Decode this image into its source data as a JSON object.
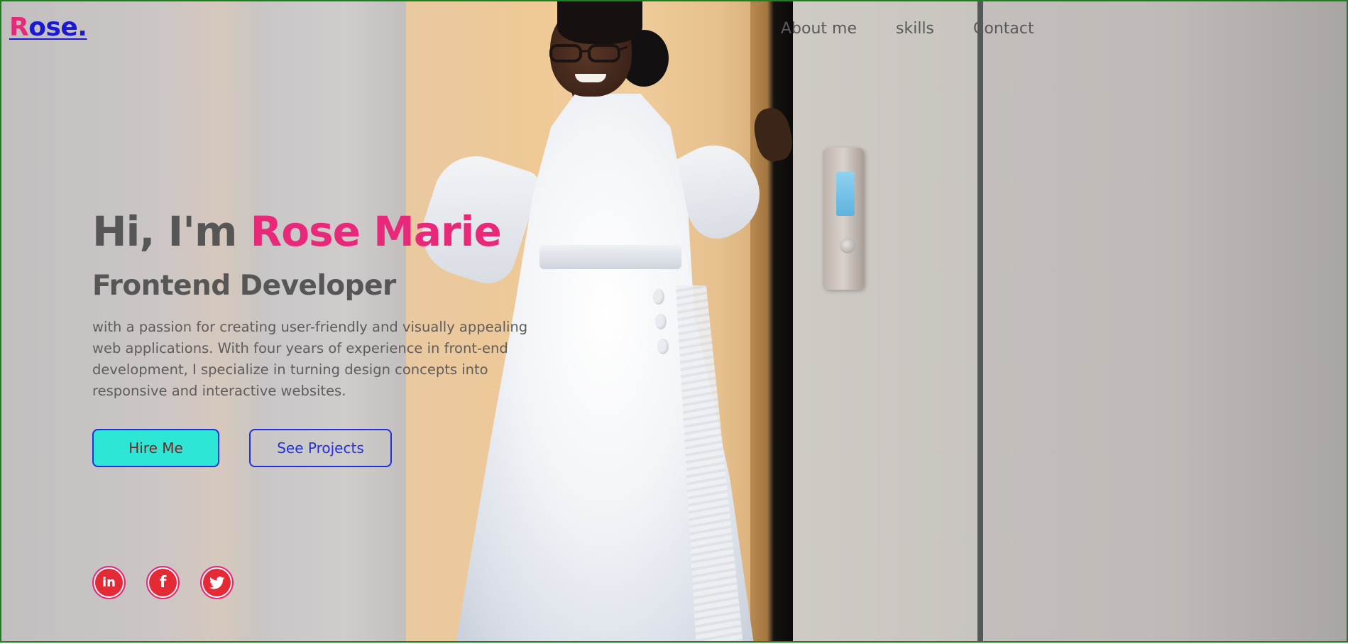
{
  "logo": {
    "initial": "R",
    "rest": "ose."
  },
  "nav": {
    "items": [
      {
        "label": "About me"
      },
      {
        "label": "skills"
      },
      {
        "label": "Contact"
      }
    ]
  },
  "hero": {
    "greeting": "Hi, I'm ",
    "name": "Rose Marie",
    "role": "Frontend Developer",
    "bio": "with a passion for creating user-friendly and visually appealing web applications. With four years of experience in front-end development, I specialize in turning design concepts into responsive and interactive websites.",
    "buttons": {
      "hire": "Hire Me",
      "projects": "See Projects"
    }
  },
  "socials": [
    {
      "icon": "linkedin-icon",
      "glyph": "in"
    },
    {
      "icon": "facebook-icon",
      "glyph": "f"
    },
    {
      "icon": "twitter-icon"
    }
  ],
  "colors": {
    "accent_pink": "#e8297a",
    "accent_blue": "#2230d8",
    "button_teal": "#2ee6d6",
    "social_red": "#e42a34",
    "text_gray": "#575657",
    "frame_green": "#1e7f1e"
  }
}
